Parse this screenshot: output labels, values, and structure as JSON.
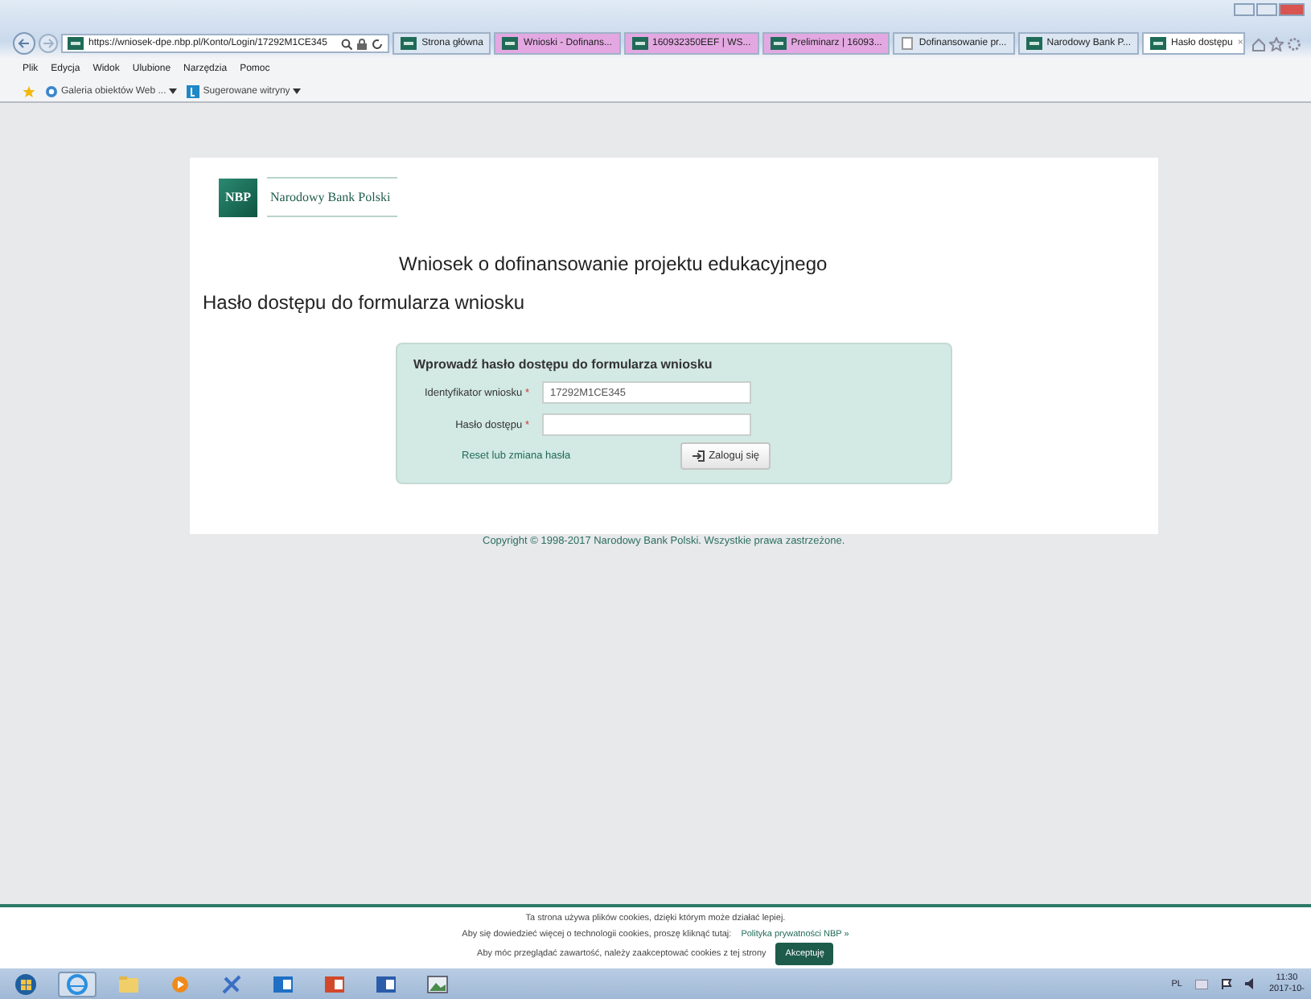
{
  "browser": {
    "address": "https://wniosek-dpe.nbp.pl/Konto/Login/17292M1CE345",
    "tabs": [
      {
        "label": "Strona główna",
        "grouped": false,
        "selected": false
      },
      {
        "label": "Wnioski - Dofinans...",
        "grouped": true,
        "selected": false
      },
      {
        "label": "160932350EEF | WS...",
        "grouped": true,
        "selected": false
      },
      {
        "label": "Preliminarz | 16093...",
        "grouped": true,
        "selected": false
      },
      {
        "label": "Dofinansowanie pr...",
        "grouped": false,
        "selected": false
      },
      {
        "label": "Narodowy Bank P...",
        "grouped": false,
        "selected": false
      },
      {
        "label": "Hasło dostępu",
        "grouped": false,
        "selected": true,
        "close": "×"
      }
    ],
    "menu": [
      "Plik",
      "Edycja",
      "Widok",
      "Ulubione",
      "Narzędzia",
      "Pomoc"
    ],
    "favorites": [
      "Galeria obiektów Web ...",
      "Sugerowane witryny"
    ]
  },
  "page": {
    "logo_mark": "NBP",
    "logo_text": "Narodowy Bank Polski",
    "heading": "Wniosek o dofinansowanie projektu edukacyjnego",
    "subheading": "Hasło dostępu do formularza wniosku",
    "form": {
      "title": "Wprowadź hasło dostępu do formularza wniosku",
      "fields": [
        {
          "label": "Identyfikator wniosku",
          "required_mark": "*",
          "value": "17292M1CE345"
        },
        {
          "label": "Hasło dostępu",
          "required_mark": "*"
        }
      ],
      "reset_link": "Reset lub zmiana hasła",
      "login_button": "Zaloguj się"
    },
    "copyright": "Copyright © 1998-2017 Narodowy Bank Polski. Wszystkie prawa zastrzeżone."
  },
  "cookie_bar": {
    "line1": "Ta strona używa plików cookies, dzięki którym może działać lepiej.",
    "line2": "Aby się dowiedzieć więcej o technologii cookies, proszę kliknąć tutaj:",
    "policy_link": "Polityka prywatności NBP »",
    "line3": "Aby móc przeglądać zawartość, należy zaakceptować cookies z tej strony",
    "accept_button": "Akceptuję"
  },
  "taskbar": {
    "language": "PL",
    "time": "11:30",
    "date": "2017-10-"
  }
}
